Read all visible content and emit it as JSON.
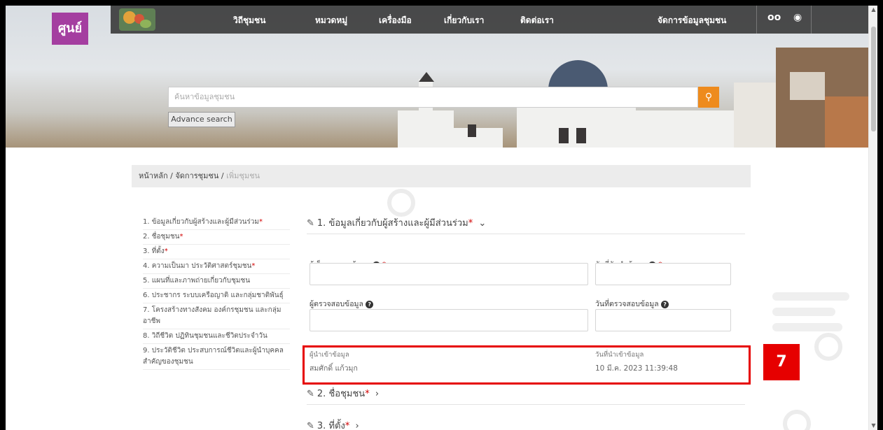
{
  "brand": {
    "logo_text": "ศูนย์",
    "site_icon": "community-logo-icon"
  },
  "nav": {
    "items": [
      "วิถีชุมชน",
      "หมวดหมู่",
      "เครื่องมือ",
      "เกี่ยวกับเรา",
      "ติดต่อเรา"
    ],
    "manage_label": "จัดการข้อมูลชุมชน",
    "accessibility_icon": "glasses-icon",
    "user_icon": "user-circle-icon"
  },
  "search": {
    "placeholder": "ค้นหาข้อมูลชุมชน",
    "button_icon": "search-icon",
    "advance_label": "Advance search"
  },
  "breadcrumb": {
    "home": "หน้าหลัก",
    "sep": "/",
    "section": "จัดการชุมชน",
    "current": "เพิ่มชุมชน"
  },
  "sidenav": [
    {
      "label": "1. ข้อมูลเกี่ยวกับผู้สร้างและผู้มีส่วนร่วม",
      "required": true
    },
    {
      "label": "2. ชื่อชุมชน",
      "required": true
    },
    {
      "label": "3. ที่ตั้ง",
      "required": true
    },
    {
      "label": "4. ความเป็นมา ประวัติศาสตร์ชุมชน",
      "required": true
    },
    {
      "label": "5. แผนที่และภาพถ่ายเกี่ยวกับชุมชน",
      "required": false
    },
    {
      "label": "6. ประชากร ระบบเครือญาติ และกลุ่มชาติพันธุ์",
      "required": false
    },
    {
      "label": "7. โครงสร้างทางสังคม องค์กรชุมชน และกลุ่มอาชีพ",
      "required": false
    },
    {
      "label": "8. วิถีชีวิต ปฏิทินชุมชนและชีวิตประจำวัน",
      "required": false
    },
    {
      "label": "9. ประวัติชีวิต ประสบการณ์ชีวิตและผู้นำบุคคลสำคัญของชุมชน",
      "required": false
    }
  ],
  "form": {
    "section1": {
      "title": "1. ข้อมูลเกี่ยวกับผู้สร้างและผู้มีส่วนร่วม",
      "required_mark": "*",
      "edit_icon": "edit-icon",
      "toggle_icon": "chevron-down-icon"
    },
    "collector_label": "ผู้เก็บรวบรวมข้อมูล",
    "collect_date_label": "วันที่จัดทำข้อมูล",
    "reviewer_label": "ผู้ตรวจสอบข้อมูล",
    "review_date_label": "วันที่ตรวจสอบข้อมูล",
    "creator_label": "ผู้นำเข้าข้อมูล",
    "creator_value": "สมศักดิ์ แก้วมุก",
    "create_date_label": "วันที่นำเข้าข้อมูล",
    "create_date_value": "10 มี.ค. 2023 11:39:48",
    "section2": {
      "title": "2. ชื่อชุมชน",
      "required_mark": "*",
      "edit_icon": "edit-icon",
      "toggle_icon": "chevron-right-icon"
    },
    "section3": {
      "title": "3. ที่ตั้ง",
      "required_mark": "*",
      "edit_icon": "edit-icon",
      "toggle_icon": "chevron-right-icon"
    }
  },
  "annotation": {
    "number": "7",
    "color": "#e60000"
  },
  "colors": {
    "accent_orange": "#ee8b1d",
    "logo_purple": "#a43ea0",
    "highlight_red": "#e60000"
  }
}
